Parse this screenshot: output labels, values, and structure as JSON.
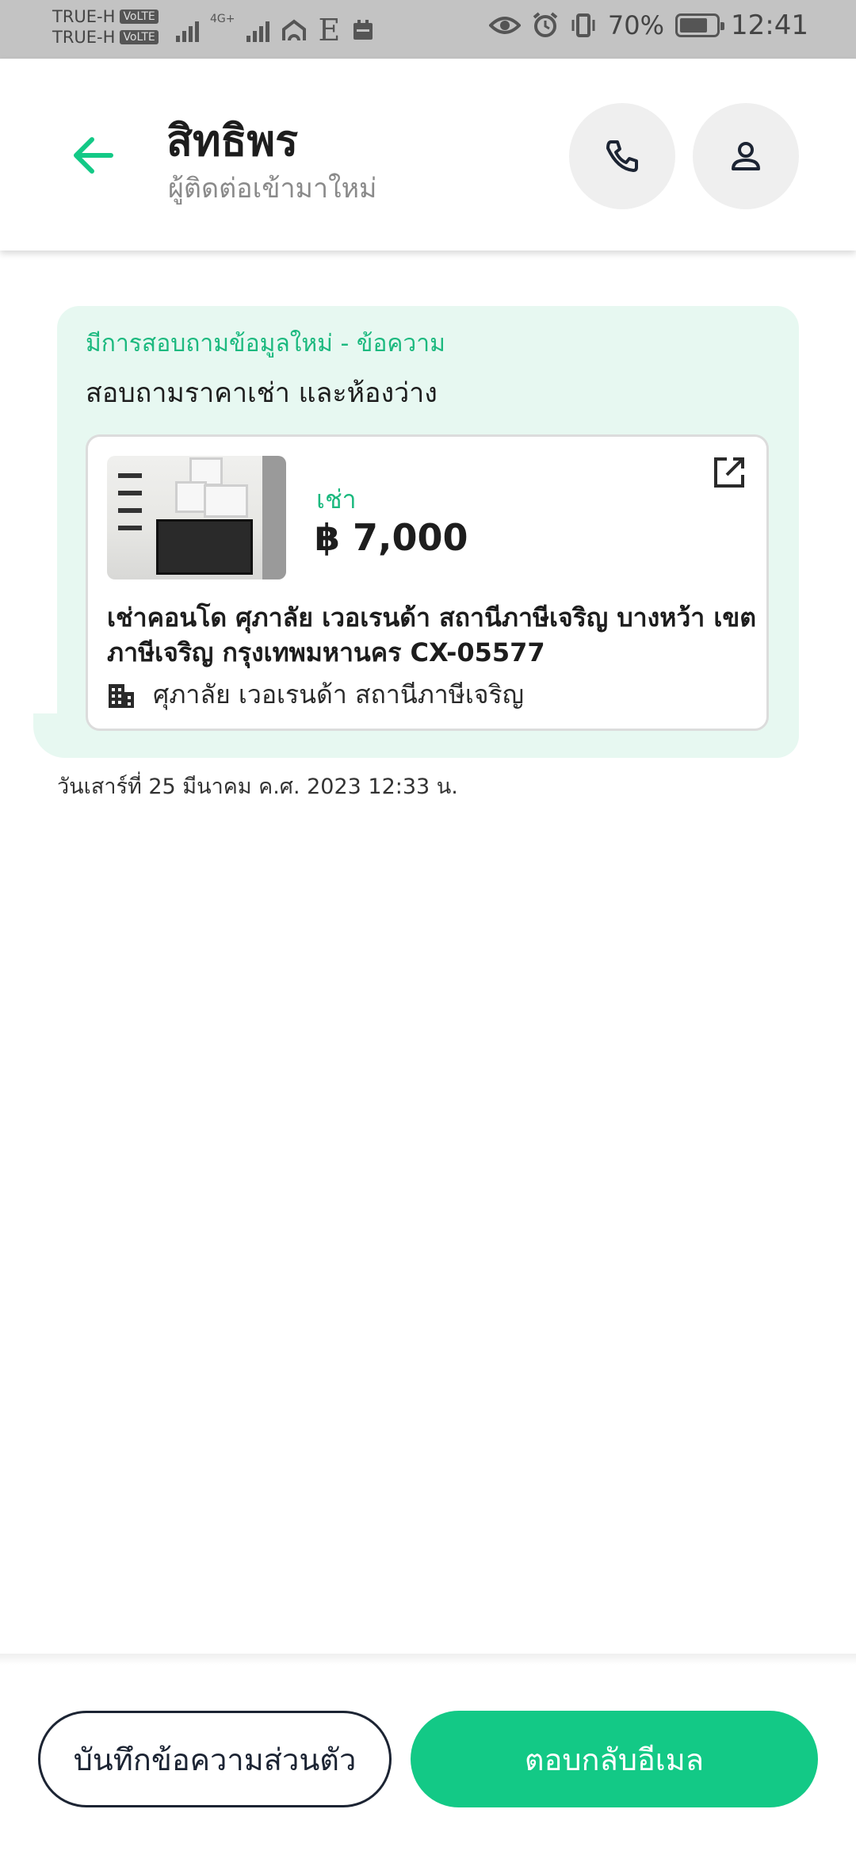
{
  "status_bar": {
    "carrier_1": "TRUE-H",
    "carrier_2": "TRUE-H",
    "volte_badge": "VoLTE",
    "network": "4G+",
    "letter_e": "E",
    "battery": "70%",
    "time": "12:41"
  },
  "header": {
    "title": "สิทธิพร",
    "subtitle": "ผู้ติดต่อเข้ามาใหม่"
  },
  "message": {
    "label": "มีการสอบถามข้อมูลใหม่ - ข้อความ",
    "text": "สอบถามราคาเช่า และห้องว่าง",
    "listing": {
      "type_label": "เช่า",
      "price": "฿ 7,000",
      "title": "เช่าคอนโด ศุภาลัย เวอเรนด้า สถานีภาษีเจริญ บางหว้า เขต ภาษีเจริญ กรุงเทพมหานคร CX-05577",
      "building": "ศุภาลัย เวอเรนด้า สถานีภาษีเจริญ"
    },
    "timestamp": "วันเสาร์ที่ 25 มีนาคม ค.ศ. 2023 12:33 น."
  },
  "actions": {
    "note_button": "บันทึกข้อความส่วนตัว",
    "reply_button": "ตอบกลับอีเมล"
  },
  "colors": {
    "accent": "#13c986",
    "bubble": "#e7f8f1",
    "dark": "#1c2433"
  }
}
